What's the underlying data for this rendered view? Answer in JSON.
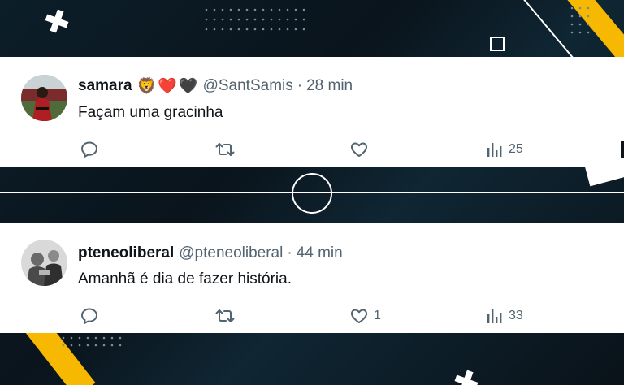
{
  "colors": {
    "accent_yellow": "#f6b800",
    "background_dark": "#0b1a24",
    "card_bg": "#ffffff",
    "text_primary": "#0f1419",
    "text_secondary": "#536471"
  },
  "tweets": [
    {
      "display_name": "samara",
      "emoji_badges": [
        "🦁",
        "❤️",
        "🖤"
      ],
      "handle": "@SantSamis",
      "separator": "·",
      "time": "28 min",
      "text": "Façam uma gracinha",
      "actions": {
        "reply_icon": "reply-icon",
        "retweet_icon": "retweet-icon",
        "like_icon": "heart-icon",
        "like_count": "",
        "views_icon": "views-chart-icon",
        "views_count": "25"
      }
    },
    {
      "display_name": "pteneoliberal",
      "emoji_badges": [],
      "handle": "@pteneoliberal",
      "separator": "·",
      "time": "44 min",
      "text": "Amanhã é dia de fazer história.",
      "actions": {
        "reply_icon": "reply-icon",
        "retweet_icon": "retweet-icon",
        "like_icon": "heart-icon",
        "like_count": "1",
        "views_icon": "views-chart-icon",
        "views_count": "33"
      }
    }
  ]
}
